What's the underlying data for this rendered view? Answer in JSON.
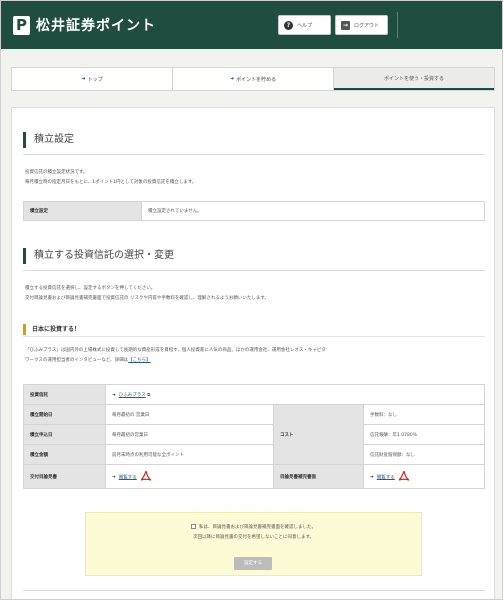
{
  "header": {
    "logo_mark": "P",
    "title": "松井証券ポイント",
    "help_label": "ヘルプ",
    "logout_label": "ログアウト"
  },
  "tabs": [
    {
      "label": "トップ",
      "active": false
    },
    {
      "label": "ポイントを貯める",
      "active": false
    },
    {
      "label": "ポイントを使う・投資する",
      "active": true
    }
  ],
  "section1": {
    "title": "積立設定",
    "desc_line1": "投資信託の積立設定状況です。",
    "desc_line2": "毎月積立時の指定月日をもとに、1ポイント1円として対象の投資信託を積立します。",
    "table": {
      "label": "積立設定",
      "value": "積立設定されていません。"
    }
  },
  "section2": {
    "title": "積立する投資信託の選択・変更",
    "desc_line1": "積立する投資信託を選択し、設定するボタンを押してください。",
    "desc_line2": "交付目論見書および目論見書補完書面で投資信託の リスクや内容や手数料を確認し、理解されるようお願いいたします。"
  },
  "fund": {
    "heading": "日本に投資する！",
    "desc_line1": "「ひふみプラス」は国内外の上場株式に投資して長期的な資産形成を目指す、個人投資家に人気の商品。ほかの運用会社、運用会社レオス・キャピタ",
    "desc_line2": "ワークスの運用担当者のインタビューなど、詳細は",
    "desc_link": "【こちら】",
    "rows": {
      "fund_name_label": "投資信託",
      "fund_name_value": "ひふみプラス",
      "start_date_label": "積立開始日",
      "start_date_value": "毎月最初の 営業日",
      "deposit_date_label": "積立申込日",
      "deposit_date_value": "毎月最初の営業日",
      "amount_label": "積立金額",
      "amount_value": "前月末時点の利用可能な全ポイント",
      "prospectus_label": "交付目論見書",
      "prospectus_value": "閲覧する",
      "cost_label": "コスト",
      "cost_fee": "手数料：なし",
      "cost_trust_fee": "信託報酬：年1.0780%",
      "cost_retention": "信託財産留保額：なし",
      "supplement_label": "目論見書補完書面",
      "supplement_value": "閲覧する"
    }
  },
  "agreement": {
    "line1": "私は、目論見書および目論見書補完書面を確認しました。",
    "line2": "次回以降に目論見書の交付を希望しないことに同意します。",
    "button": "設定する"
  },
  "colors": {
    "brand_green": "#1f4d3f",
    "accent_yellow": "#d9a100",
    "agree_bg": "#fcfbd6"
  }
}
